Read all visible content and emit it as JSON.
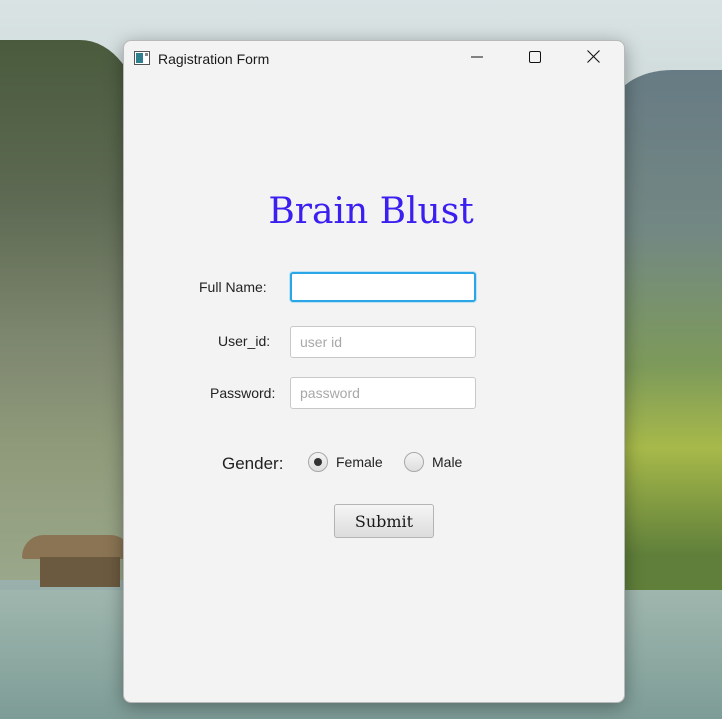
{
  "window": {
    "title": "Ragistration Form"
  },
  "form": {
    "heading": "Brain Blust",
    "heading_color": "#3a1ff0",
    "full_name": {
      "label": "Full Name:",
      "value": "",
      "placeholder": ""
    },
    "user_id": {
      "label": "User_id:",
      "value": "",
      "placeholder": "user id"
    },
    "password": {
      "label": "Password:",
      "value": "",
      "placeholder": "password"
    },
    "gender": {
      "label": "Gender:",
      "options": [
        {
          "label": "Female",
          "selected": true
        },
        {
          "label": "Male",
          "selected": false
        }
      ]
    },
    "submit_label": "Submit"
  },
  "icons": {
    "app": "window-app-icon",
    "minimize": "minimize-icon",
    "maximize": "maximize-icon",
    "close": "close-icon"
  },
  "colors": {
    "focus_border": "#2aa6e6",
    "window_bg": "#f3f3f3"
  }
}
